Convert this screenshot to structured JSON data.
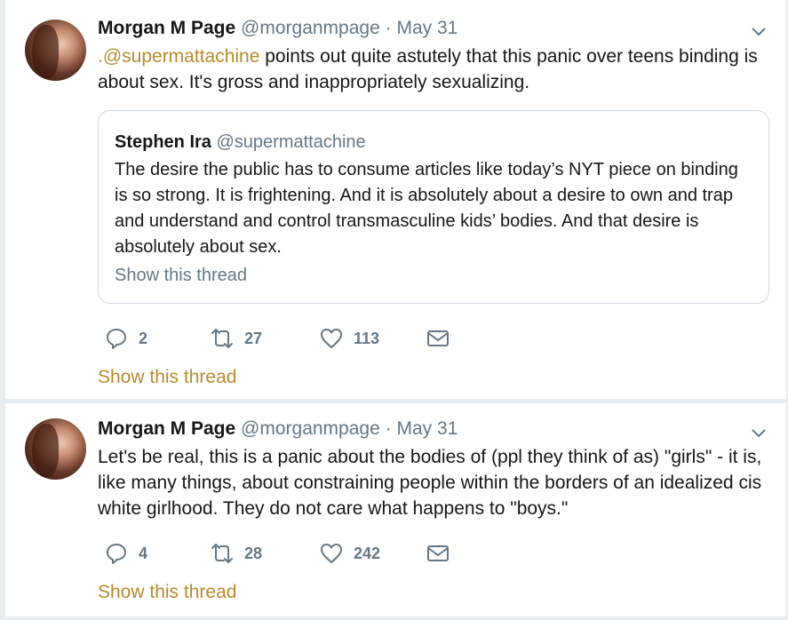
{
  "tweets": [
    {
      "author": "Morgan M Page",
      "handle": "@morganmpage",
      "separator": "·",
      "date": "May 31",
      "mention": ".@supermattachine",
      "text_after_mention": " points out quite astutely that this panic over teens binding is about sex. It's gross and inappropriately sexualizing.",
      "quote": {
        "author": "Stephen Ira",
        "handle": "@supermattachine",
        "text": "The desire the public has to consume articles like today’s NYT piece on binding is so strong. It is frightening. And it is absolutely about a desire to own and trap and understand and control transmasculine kids’ bodies. And that desire is absolutely about sex.",
        "show_thread": "Show this thread"
      },
      "replies": "2",
      "retweets": "27",
      "likes": "113",
      "show_thread": "Show this thread"
    },
    {
      "author": "Morgan M Page",
      "handle": "@morganmpage",
      "separator": "·",
      "date": "May 31",
      "text": "Let's be real, this is a panic about the bodies of (ppl they think of as) \"girls\" - it is, like many things, about constraining people within the borders of an idealized cis white girlhood. They do not care what happens to \"boys.\"",
      "replies": "4",
      "retweets": "28",
      "likes": "242",
      "show_thread": "Show this thread"
    }
  ],
  "icons": {
    "reply": "reply-icon",
    "retweet": "retweet-icon",
    "like": "heart-icon",
    "dm": "envelope-icon",
    "more": "chevron-down-icon"
  },
  "colors": {
    "link": "#b58b2e",
    "secondary": "#657786",
    "background": "#e6ecf0"
  }
}
